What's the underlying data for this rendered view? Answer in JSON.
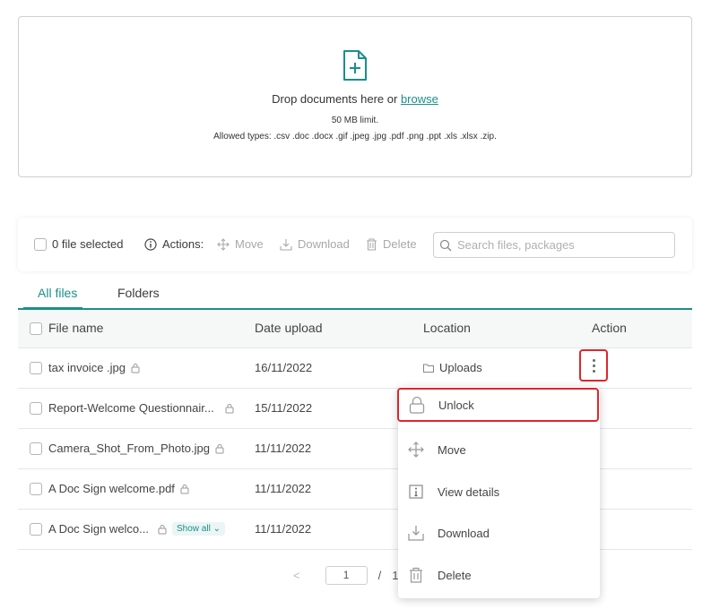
{
  "dropzone": {
    "drop_text": "Drop documents here or ",
    "browse_link": "browse",
    "limit": "50 MB limit.",
    "allowed_types": "Allowed types: .csv .doc .docx .gif .jpeg .jpg .pdf .png .ppt .xls .xlsx .zip."
  },
  "toolbar": {
    "selected": "0 file selected",
    "actions_label": "Actions:",
    "move": "Move",
    "download": "Download",
    "delete": "Delete",
    "search_placeholder": "Search files, packages"
  },
  "tabs": [
    {
      "label": "All files",
      "active": true
    },
    {
      "label": "Folders",
      "active": false
    }
  ],
  "columns": [
    "File name",
    "Date upload",
    "Location",
    "Action"
  ],
  "rows": [
    {
      "name": "tax invoice .jpg",
      "date": "16/11/2022",
      "location": "Uploads",
      "locked": true
    },
    {
      "name": "Report-Welcome Questionnair...",
      "date": "15/11/2022",
      "location": "",
      "locked": true
    },
    {
      "name": "Camera_Shot_From_Photo.jpg",
      "date": "11/11/2022",
      "location": "",
      "locked": true
    },
    {
      "name": "A Doc Sign welcome.pdf",
      "date": "11/11/2022",
      "location": "",
      "locked": true
    },
    {
      "name": "A Doc Sign welco...",
      "date": "11/11/2022",
      "location": "",
      "locked": true,
      "badge": "Show all"
    }
  ],
  "pagination": {
    "current": "1",
    "separator": "/",
    "total": "1",
    "prev": "<"
  },
  "context_menu": {
    "items": [
      {
        "label": "Unlock",
        "icon": "lock-icon",
        "highlighted": true
      },
      {
        "label": "Move",
        "icon": "move-icon"
      },
      {
        "label": "View details",
        "icon": "info-icon"
      },
      {
        "label": "Download",
        "icon": "download-icon"
      },
      {
        "label": "Delete",
        "icon": "trash-icon"
      }
    ]
  },
  "colors": {
    "accent": "#1a8f8a",
    "highlight": "#e0252c"
  }
}
